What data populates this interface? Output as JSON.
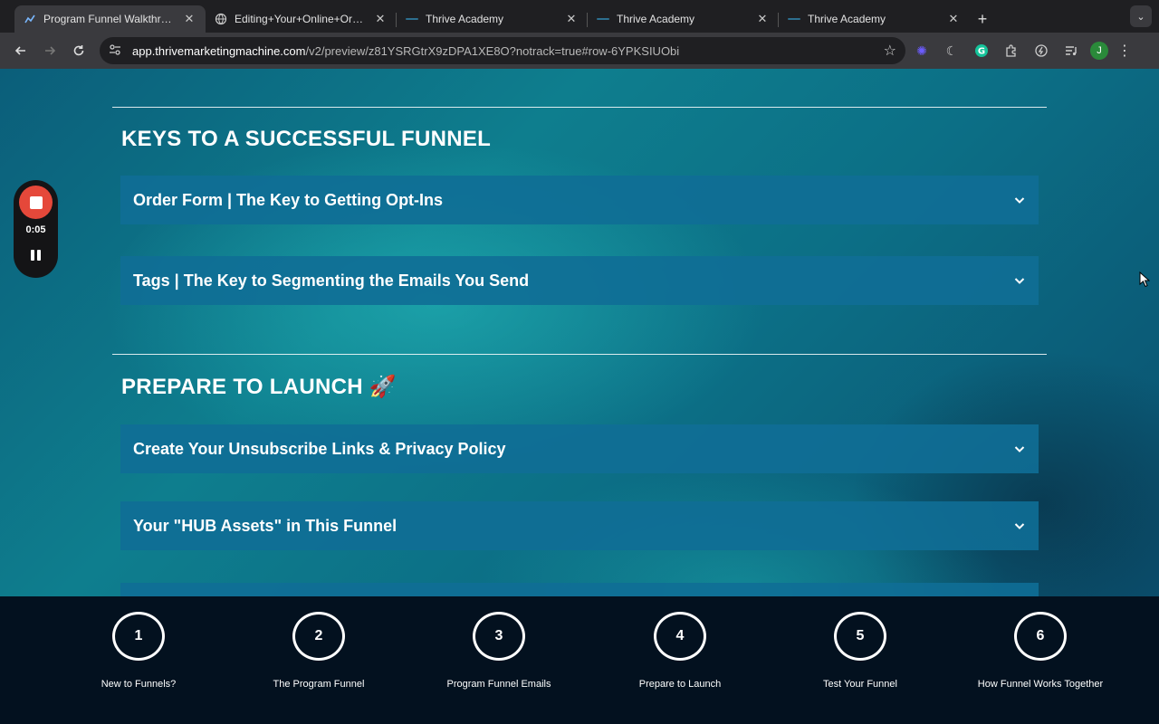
{
  "browser": {
    "tabs": [
      {
        "title": "Program Funnel Walkthrough",
        "favicon": "chart-favicon",
        "active": true
      },
      {
        "title": "Editing+Your+Online+Order+Form",
        "favicon": "globe-icon",
        "active": false
      },
      {
        "title": "Thrive Academy",
        "favicon": "thrive-favicon",
        "active": false
      },
      {
        "title": "Thrive Academy",
        "favicon": "thrive-favicon",
        "active": false
      },
      {
        "title": "Thrive Academy",
        "favicon": "thrive-favicon",
        "active": false
      }
    ],
    "url_host": "app.thrivemarketingmachine.com",
    "url_path": "/v2/preview/z81YSRGtrX9zDPA1XE8O?notrack=true#row-6YPKSIUObi",
    "profile_initial": "J"
  },
  "recorder": {
    "elapsed": "0:05",
    "stop_color": "#e5483a"
  },
  "sections": [
    {
      "title": "KEYS TO A SUCCESSFUL FUNNEL",
      "items": [
        {
          "label": "Order Form | The Key to Getting Opt-Ins"
        },
        {
          "label": "Tags | The Key to Segmenting the Emails You Send"
        }
      ]
    },
    {
      "title": "PREPARE TO LAUNCH 🚀",
      "items": [
        {
          "label": "Create Your Unsubscribe Links & Privacy Policy"
        },
        {
          "label": "Your \"HUB Assets\" in This Funnel"
        },
        {
          "label": ""
        }
      ]
    }
  ],
  "steps": [
    {
      "number": "1",
      "label": "New to Funnels?"
    },
    {
      "number": "2",
      "label": "The Program Funnel"
    },
    {
      "number": "3",
      "label": "Program Funnel Emails"
    },
    {
      "number": "4",
      "label": "Prepare to Launch"
    },
    {
      "number": "5",
      "label": "Test Your Funnel"
    },
    {
      "number": "6",
      "label": "How Funnel Works Together"
    }
  ],
  "colors": {
    "accordion_bg": "#106e96",
    "footer_bg": "#03111f",
    "accent_teal": "#1ab3b3"
  }
}
